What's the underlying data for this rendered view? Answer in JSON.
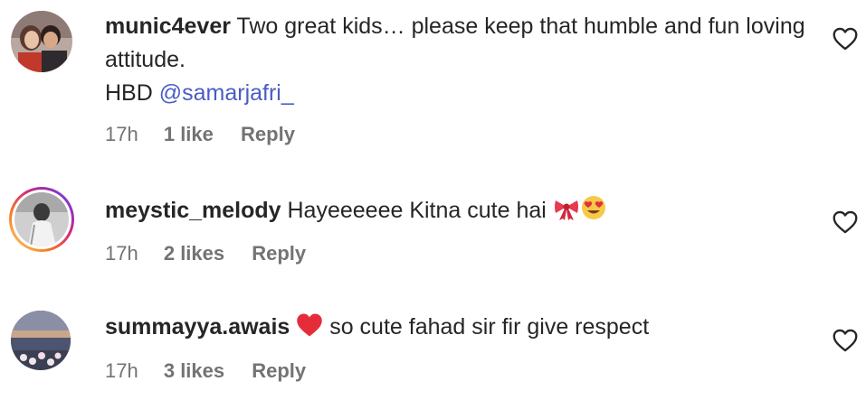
{
  "comments": [
    {
      "username": "munic4ever",
      "text": "Two great kids… please keep that humble and fun loving attitude.",
      "text2": "HBD ",
      "mention": "@samarjafri_",
      "time": "17h",
      "likes": "1 like",
      "reply": "Reply"
    },
    {
      "username": "meystic_melody",
      "text": "Hayeeeeee Kitna cute hai",
      "time": "17h",
      "likes": "2 likes",
      "reply": "Reply"
    },
    {
      "username": "summayya.awais",
      "text": "so cute fahad sir fir give respect",
      "time": "17h",
      "likes": "3 likes",
      "reply": "Reply"
    }
  ],
  "icons": {
    "like": "heart-outline-icon",
    "ribbon": "ribbon-emoji",
    "heart_eyes": "heart-eyes-emoji",
    "red_heart": "red-heart-emoji"
  },
  "colors": {
    "text": "#262626",
    "secondary": "#737373",
    "mention": "#4a5cc5"
  }
}
